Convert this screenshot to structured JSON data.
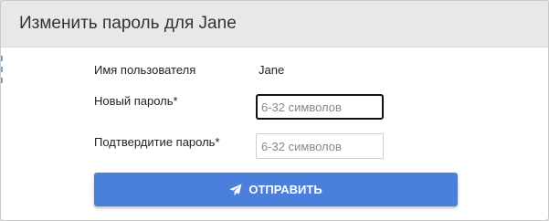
{
  "dialog": {
    "title": "Изменить пароль для Jane"
  },
  "form": {
    "username_label": "Имя пользователя",
    "username_value": "Jane",
    "new_password_label": "Новый пароль*",
    "new_password_placeholder": "6-32 символов",
    "new_password_value": "",
    "confirm_password_label": "Подтвердитие пароль*",
    "confirm_password_placeholder": "6-32 символов",
    "confirm_password_value": ""
  },
  "submit": {
    "label": "ОТПРАВИТЬ",
    "icon": "paper-plane-icon"
  },
  "colors": {
    "header_bg": "#e8e8e8",
    "button_bg": "#4a7fdc",
    "focused_border": "#111111"
  }
}
